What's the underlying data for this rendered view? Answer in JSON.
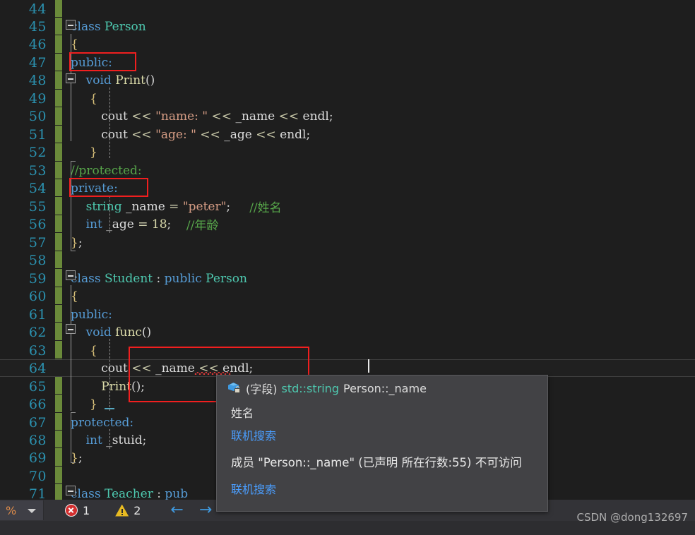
{
  "editor": {
    "theme_background": "#1e1e1e",
    "line_number_color": "#2b91af",
    "change_bar_color": "#6a8a3a",
    "annotation_box_color": "#f01f1f",
    "first_visible_line": 44,
    "current_line": 64,
    "lines": [
      {
        "num": 44,
        "text": ""
      },
      {
        "num": 45,
        "text": "class Person"
      },
      {
        "num": 46,
        "text": "{"
      },
      {
        "num": 47,
        "text": "public:"
      },
      {
        "num": 48,
        "text": "    void Print()"
      },
      {
        "num": 49,
        "text": "    {"
      },
      {
        "num": 50,
        "text": "        cout << \"name: \" << _name << endl;"
      },
      {
        "num": 51,
        "text": "        cout << \"age: \" << _age << endl;"
      },
      {
        "num": 52,
        "text": "    }"
      },
      {
        "num": 53,
        "text": "//protected:"
      },
      {
        "num": 54,
        "text": "private:"
      },
      {
        "num": 55,
        "text": "    string _name = \"peter\";    //姓名"
      },
      {
        "num": 56,
        "text": "    int _age = 18;    //年龄"
      },
      {
        "num": 57,
        "text": "};"
      },
      {
        "num": 58,
        "text": ""
      },
      {
        "num": 59,
        "text": "class Student : public Person"
      },
      {
        "num": 60,
        "text": "{"
      },
      {
        "num": 61,
        "text": "public:"
      },
      {
        "num": 62,
        "text": "    void func()"
      },
      {
        "num": 63,
        "text": "    {"
      },
      {
        "num": 64,
        "text": "        cout << _name << endl;"
      },
      {
        "num": 65,
        "text": "        Print();"
      },
      {
        "num": 66,
        "text": "    }"
      },
      {
        "num": 67,
        "text": "protected:"
      },
      {
        "num": 68,
        "text": "    int _stuid;"
      },
      {
        "num": 69,
        "text": "};"
      },
      {
        "num": 70,
        "text": ""
      },
      {
        "num": 71,
        "text": "class Teacher : pub"
      }
    ],
    "tokens": {
      "kw_class": "class",
      "kw_public": "public:",
      "kw_private": "private:",
      "kw_protected": "protected:",
      "kw_void": "void",
      "kw_int": "int",
      "type_string": "string",
      "type_person": "Person",
      "type_student": "Student",
      "type_teacher": "Teacher",
      "fn_print": "Print",
      "fn_func": "func",
      "id_cout": "cout",
      "id_endl": "endl",
      "id_name": "_name",
      "id_age": "_age",
      "id_stuid": "_stuid",
      "str_name_label": "\"name: \"",
      "str_age_label": "\"age: \"",
      "str_peter": "\"peter\"",
      "num_18": "18",
      "cmt_protected": "//protected:",
      "cmt_xingming": "//姓名",
      "cmt_nianling": "//年龄",
      "op_shift": "<<",
      "op_assign": "=",
      "op_colon": ":",
      "op_semi": ";",
      "brace_open": "{",
      "brace_close": "}",
      "parens": "()",
      "pub_partial": "pub"
    },
    "annotations": [
      {
        "name": "highlight-public-line-47",
        "target": "public:"
      },
      {
        "name": "highlight-private-line-54",
        "target": "private:"
      },
      {
        "name": "highlight-func-body-lines-64-65",
        "target": "cout << _name << endl; Print();"
      }
    ]
  },
  "tooltip": {
    "icon": "field-lock-icon",
    "signature_prefix": "(字段) ",
    "signature_type": "std::string",
    "signature_name": " Person::_name",
    "description": "姓名",
    "online_search_1": "联机搜索",
    "error_message": "成员 \"Person::_name\" (已声明 所在行数:55) 不可访问",
    "online_search_2": "联机搜索",
    "error_box_color": "#f01f1f",
    "link_color": "#4a9eff"
  },
  "statusbar": {
    "zoom_value": "%",
    "zoom_dropdown_icon": "chevron-down-icon",
    "error_icon": "error-circle-icon",
    "error_count": "1",
    "warning_icon": "warning-triangle-icon",
    "warning_count": "2",
    "prev_icon": "arrow-left-icon",
    "prev_glyph": "←",
    "next_icon": "arrow-right-icon",
    "next_glyph": "→"
  },
  "watermark": {
    "text": "CSDN @dong132697"
  }
}
